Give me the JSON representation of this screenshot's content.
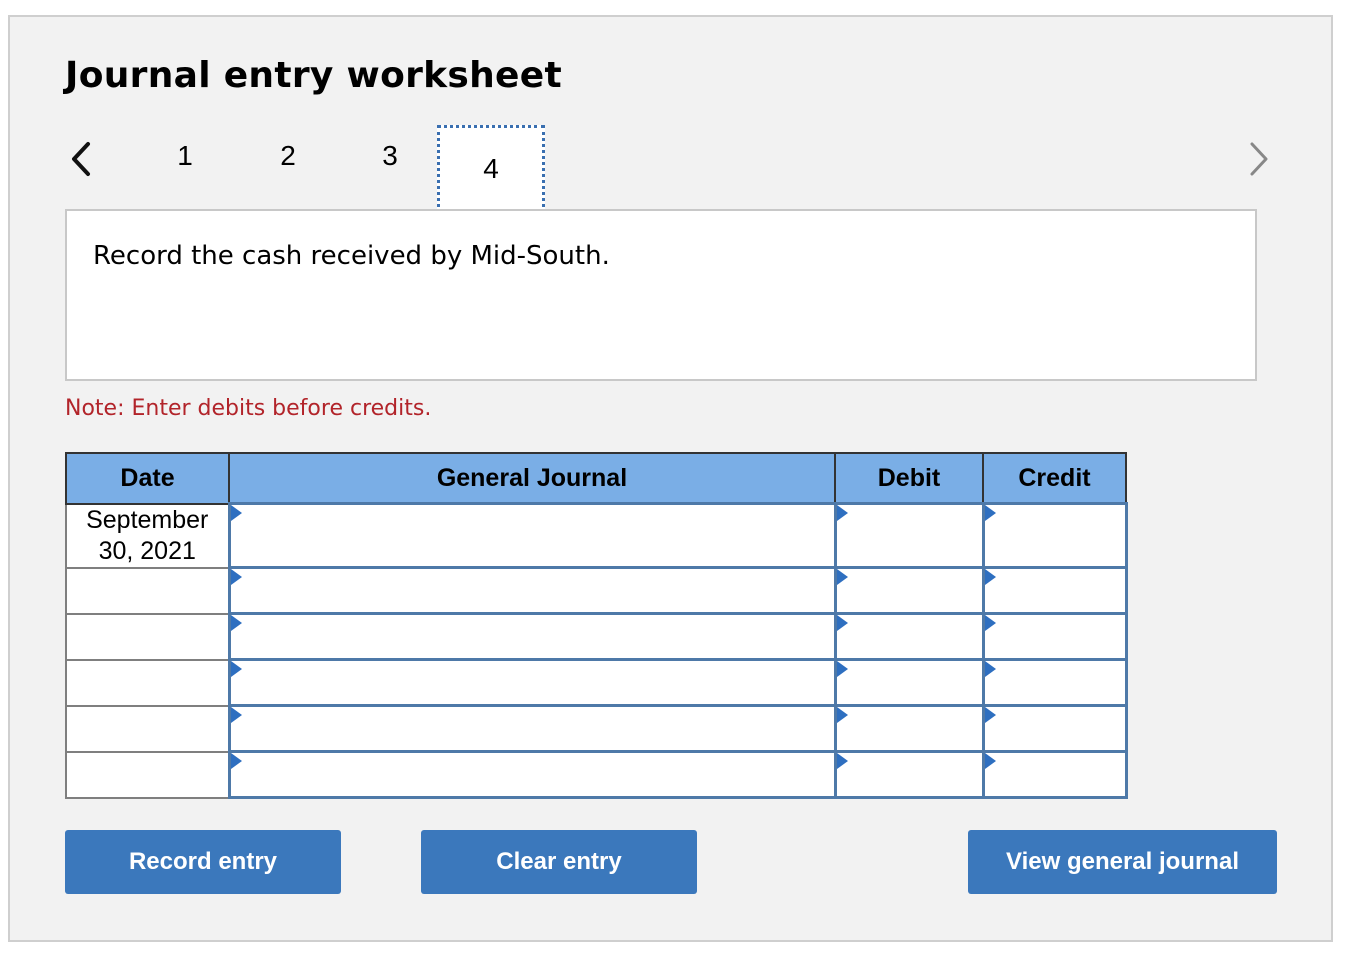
{
  "worksheet": {
    "title": "Journal entry worksheet",
    "steps": [
      "1",
      "2",
      "3",
      "4"
    ],
    "active_step": "4",
    "prev_icon": "chevron-left-icon",
    "next_icon": "chevron-right-icon"
  },
  "instruction": {
    "text": "Record the cash received by Mid-South."
  },
  "note": {
    "text": "Note: Enter debits before credits.",
    "color": "#b2242a"
  },
  "journal_table": {
    "headers": {
      "date": "Date",
      "general_journal": "General Journal",
      "debit": "Debit",
      "credit": "Credit"
    },
    "rows": [
      {
        "date": "September 30, 2021",
        "account": "",
        "debit": "",
        "credit": ""
      },
      {
        "date": "",
        "account": "",
        "debit": "",
        "credit": ""
      },
      {
        "date": "",
        "account": "",
        "debit": "",
        "credit": ""
      },
      {
        "date": "",
        "account": "",
        "debit": "",
        "credit": ""
      },
      {
        "date": "",
        "account": "",
        "debit": "",
        "credit": ""
      },
      {
        "date": "",
        "account": "",
        "debit": "",
        "credit": ""
      }
    ],
    "header_color": "#7aaee6"
  },
  "buttons": {
    "record_entry": "Record entry",
    "clear_entry": "Clear entry",
    "view_general_journal": "View general journal",
    "color": "#3b78bc"
  }
}
